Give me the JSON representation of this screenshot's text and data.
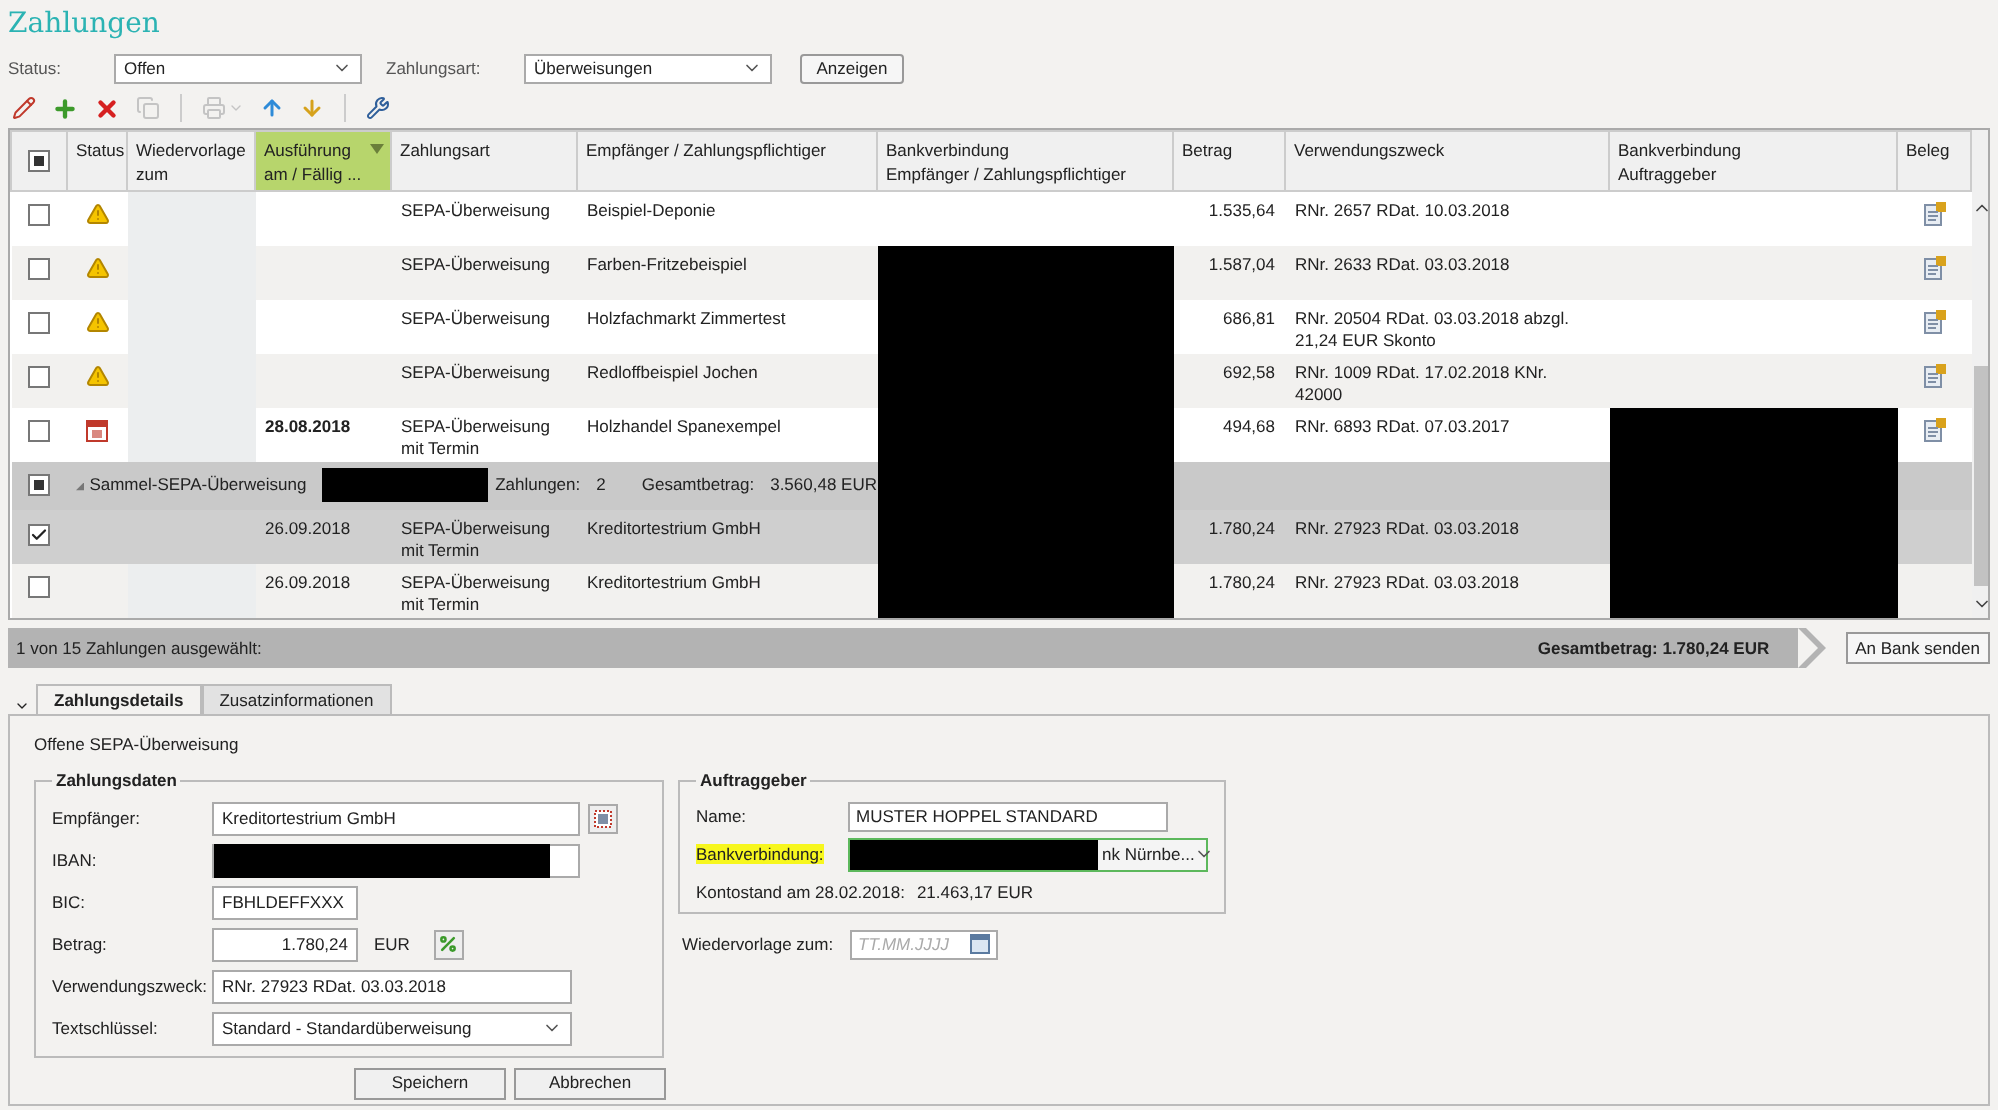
{
  "title": "Zahlungen",
  "filters": [
    {
      "label": "Status:",
      "value": "Offen"
    },
    {
      "label": "Zahlungsart:",
      "value": "Überweisungen"
    }
  ],
  "show_button": "Anzeigen",
  "toolbar": [
    {
      "kind": "edit",
      "disabled": false
    },
    {
      "kind": "add",
      "disabled": false
    },
    {
      "kind": "delete",
      "disabled": false
    },
    {
      "kind": "copy",
      "disabled": true
    },
    {
      "kind": "separator"
    },
    {
      "kind": "print",
      "disabled": true
    },
    {
      "kind": "up",
      "disabled": false
    },
    {
      "kind": "down",
      "disabled": false
    },
    {
      "kind": "separator"
    },
    {
      "kind": "tools",
      "disabled": false
    }
  ],
  "table": {
    "indeterminate": true,
    "columns": [
      {
        "label": "Status",
        "sorted": false
      },
      {
        "label": "Wiedervorlage\nzum",
        "sorted": false
      },
      {
        "label": "Ausführung\nam / Fällig ...",
        "sorted": true
      },
      {
        "label": "Zahlungsart",
        "sorted": false
      },
      {
        "label": "Empfänger / Zahlungspflichtiger",
        "sorted": false
      },
      {
        "label": "Bankverbindung\nEmpfänger / Zahlungspflichtiger",
        "sorted": false
      },
      {
        "label": "Betrag",
        "sorted": false
      },
      {
        "label": "Verwendungszweck",
        "sorted": false
      },
      {
        "label": "Bankverbindung\nAuftraggeber",
        "sorted": false
      },
      {
        "label": "Beleg",
        "sorted": false
      }
    ],
    "rows": [
      {
        "kind": "payment",
        "checked": false,
        "warning": true,
        "scheduled": false,
        "type": "SEPA-Überweisung",
        "payee": "Beispiel-Deponie",
        "amount": "1.535,64",
        "purpose": "RNr. 2657 RDat. 10.03.2018",
        "bank_redacted": false,
        "client_bank_redacted": false,
        "document": true
      },
      {
        "kind": "payment",
        "checked": false,
        "warning": true,
        "scheduled": false,
        "type": "SEPA-Überweisung",
        "payee": "Farben-Fritzebeispiel",
        "amount": "1.587,04",
        "purpose": "RNr. 2633 RDat. 03.03.2018",
        "bank_redacted": true,
        "client_bank_redacted": false,
        "document": true
      },
      {
        "kind": "payment",
        "checked": false,
        "warning": true,
        "scheduled": false,
        "type": "SEPA-Überweisung",
        "payee": "Holzfachmarkt Zimmertest",
        "amount": "686,81",
        "purpose": "RNr. 20504 RDat. 03.03.2018 abzgl. 21,24 EUR Skonto",
        "bank_redacted": true,
        "client_bank_redacted": false,
        "document": true
      },
      {
        "kind": "payment",
        "checked": false,
        "warning": true,
        "scheduled": false,
        "type": "SEPA-Überweisung",
        "payee": "Redloffbeispiel Jochen",
        "amount": "692,58",
        "purpose": "RNr. 1009 RDat. 17.02.2018 KNr. 42000",
        "bank_redacted": true,
        "client_bank_redacted": false,
        "document": true
      },
      {
        "kind": "payment",
        "checked": false,
        "warning": false,
        "scheduled": true,
        "date": "28.08.2018",
        "date_bold": true,
        "type": "SEPA-Überweisung mit Termin",
        "payee": "Holzhandel Spanexempel",
        "amount": "494,68",
        "purpose": "RNr. 6893 RDat. 07.03.2017",
        "bank_redacted": true,
        "client_bank_redacted": true,
        "document": true
      },
      {
        "kind": "group",
        "indeterminate": true,
        "expanded": true,
        "label": "Sammel-SEPA-Überweisung",
        "name_redacted": true,
        "count_label": "Zahlungen:",
        "count": "2",
        "total_label": "Gesamtbetrag:",
        "total": "3.560,48 EUR",
        "bank_redacted": true,
        "client_bank_redacted": true
      },
      {
        "kind": "payment",
        "checked": true,
        "warning": false,
        "scheduled": false,
        "date": "26.09.2018",
        "date_bold": false,
        "type": "SEPA-Überweisung mit Termin",
        "payee": "Kreditortestrium GmbH",
        "amount": "1.780,24",
        "purpose": "RNr. 27923 RDat. 03.03.2018",
        "bank_redacted": true,
        "client_bank_redacted": true,
        "document": false
      },
      {
        "kind": "payment",
        "checked": false,
        "warning": false,
        "scheduled": false,
        "date": "26.09.2018",
        "date_bold": false,
        "type": "SEPA-Überweisung mit Termin",
        "payee": "Kreditortestrium GmbH",
        "amount": "1.780,24",
        "purpose": "RNr. 27923 RDat. 03.03.2018",
        "bank_redacted": true,
        "client_bank_redacted": true,
        "document": false
      }
    ]
  },
  "status_bar": {
    "selection": "1 von 15 Zahlungen ausgewählt:",
    "total": "Gesamtbetrag: 1.780,24 EUR",
    "send_button": "An Bank senden"
  },
  "detail": {
    "expanded": true,
    "tabs": [
      {
        "label": "Zahlungsdetails",
        "selected": true
      },
      {
        "label": "Zusatzinformationen",
        "selected": false
      }
    ],
    "subtitle": "Offene SEPA-Überweisung",
    "payment_data": {
      "title": "Zahlungsdaten",
      "fields": [
        {
          "kind": "lookup",
          "label": "Empfänger:",
          "value": "Kreditortestrium GmbH"
        },
        {
          "kind": "redacted",
          "label": "IBAN:"
        },
        {
          "kind": "short",
          "label": "BIC:",
          "value": "FBHLDEFFXXX"
        },
        {
          "kind": "amount",
          "label": "Betrag:",
          "value": "1.780,24",
          "unit": "EUR"
        },
        {
          "kind": "text",
          "label": "Verwendungszweck:",
          "value": "RNr. 27923 RDat. 03.03.2018"
        },
        {
          "kind": "select",
          "label": "Textschlüssel:",
          "value": "Standard - Standardüberweisung"
        }
      ]
    },
    "client": {
      "title": "Auftraggeber",
      "name_label": "Name:",
      "name": "MUSTER HOPPEL STANDARD",
      "bank_label": "Bankverbindung:",
      "bank_highlighted": true,
      "bank_value": "nk Nürnbe...",
      "balance_label": "Kontostand am 28.02.2018:",
      "balance": "21.463,17 EUR"
    },
    "followup": {
      "label": "Wiedervorlage zum:",
      "placeholder": "TT.MM.JJJJ"
    },
    "buttons": [
      "Speichern",
      "Abbrechen"
    ]
  }
}
